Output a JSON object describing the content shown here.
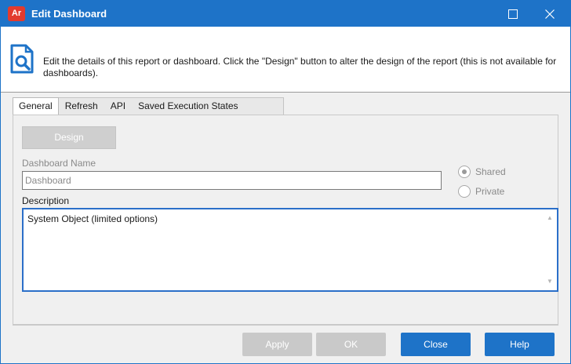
{
  "window": {
    "app_icon_text": "Ar",
    "title": "Edit Dashboard"
  },
  "header": {
    "icon": "search-document-icon",
    "text": "Edit the details of this report or dashboard.  Click the \"Design\" button to alter the design of the report (this is not available for dashboards)."
  },
  "tabs": [
    {
      "label": "General",
      "active": true
    },
    {
      "label": "Refresh",
      "active": false
    },
    {
      "label": "API",
      "active": false
    },
    {
      "label": "Saved Execution States",
      "active": false
    }
  ],
  "general": {
    "design_label": "Design",
    "name_label": "Dashboard Name",
    "name_value": "Dashboard",
    "visibility": {
      "shared_label": "Shared",
      "private_label": "Private",
      "selected": "Shared"
    },
    "description_label": "Description",
    "description_value": "System Object (limited options)"
  },
  "buttons": {
    "apply": "Apply",
    "ok": "OK",
    "close": "Close",
    "help": "Help"
  },
  "colors": {
    "accent": "#1e73c8",
    "app_icon": "#e23b2e",
    "disabled": "#c9c9c9"
  }
}
